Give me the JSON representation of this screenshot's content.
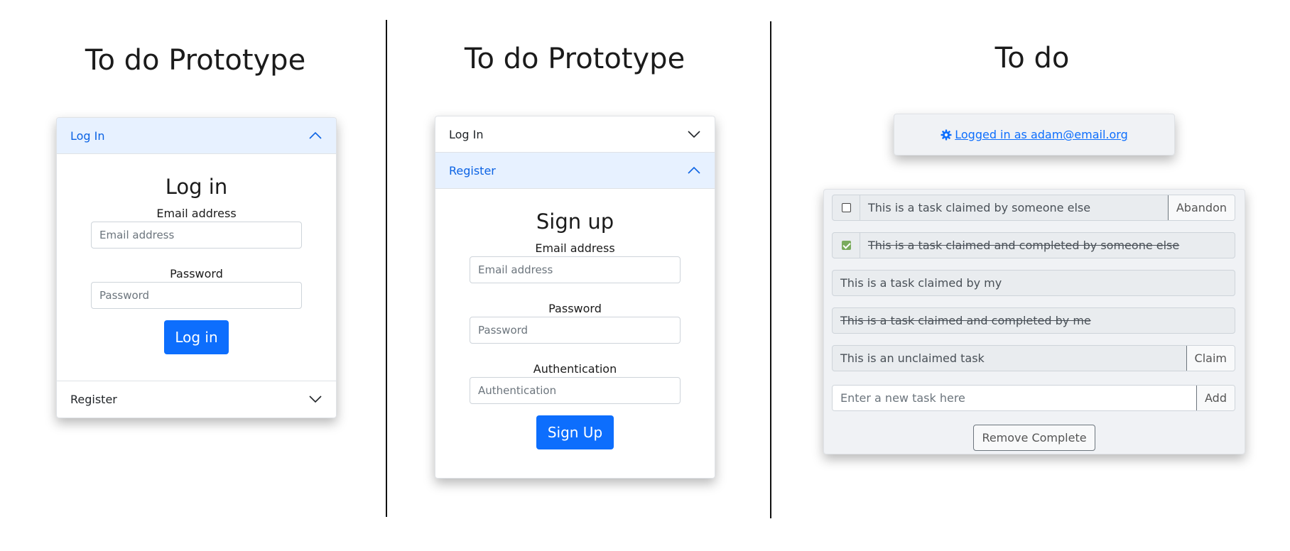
{
  "login_panel": {
    "title": "To do Prototype",
    "accordion": {
      "login_header": "Log In",
      "register_header": "Register"
    },
    "form": {
      "title": "Log in",
      "email_label": "Email address",
      "email_placeholder": "Email address",
      "password_label": "Password",
      "password_placeholder": "Password",
      "submit_label": "Log in"
    }
  },
  "register_panel": {
    "title": "To do Prototype",
    "accordion": {
      "login_header": "Log In",
      "register_header": "Register"
    },
    "form": {
      "title": "Sign up",
      "email_label": "Email address",
      "email_placeholder": "Email address",
      "password_label": "Password",
      "password_placeholder": "Password",
      "auth_label": "Authentication",
      "auth_placeholder": "Authentication",
      "submit_label": "Sign Up"
    }
  },
  "todo_panel": {
    "title": "To do",
    "status": {
      "icon": "gear-icon",
      "text": " Logged in as adam@email.org"
    },
    "tasks": [
      {
        "text": "This is a task claimed by someone else",
        "checkbox": true,
        "checked": false,
        "completed": false,
        "action": "Abandon"
      },
      {
        "text": "This is a task claimed and completed by someone else",
        "checkbox": true,
        "checked": true,
        "completed": true,
        "action": ""
      },
      {
        "text": "This is a task claimed by my",
        "checkbox": false,
        "checked": false,
        "completed": false,
        "action": ""
      },
      {
        "text": "This is a task claimed and completed by me",
        "checkbox": false,
        "checked": false,
        "completed": true,
        "action": ""
      },
      {
        "text": "This is an unclaimed task",
        "checkbox": false,
        "checked": false,
        "completed": false,
        "action": "Claim"
      }
    ],
    "new_task": {
      "placeholder": "Enter a new task here",
      "add_label": "Add"
    },
    "remove_complete_label": "Remove Complete"
  },
  "colors": {
    "primary": "#0d6efd",
    "accordion_active_bg": "#e7f1ff",
    "accordion_active_text": "#0c63e4",
    "check_complete": "#7aab5d"
  }
}
